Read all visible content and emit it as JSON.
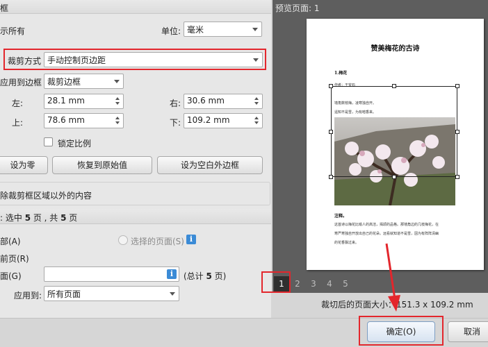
{
  "left": {
    "section1_title": "框",
    "show_all_label": "示所有",
    "unit_label": "单位:",
    "unit_value": "毫米",
    "crop_method_label": "裁剪方式",
    "crop_method_value": "手动控制页边距",
    "apply_border_label": "应用到边框",
    "apply_border_value": "裁剪边框",
    "left_label": "左:",
    "left_value": "28.1 mm",
    "right_label": "右:",
    "right_value": "30.6 mm",
    "top_label": "上:",
    "top_value": "78.6 mm",
    "bottom_label": "下:",
    "bottom_value": "109.2 mm",
    "lock_ratio_label": "锁定比例",
    "btn_set_zero": "设为零",
    "btn_restore": "恢复到原始值",
    "btn_set_blank": "设为空白外边框",
    "remove_outside_label": "除裁剪框区域以外的内容"
  },
  "pages": {
    "header_prefix": ": 选中 ",
    "header_selected": "5",
    "header_mid": " 页 , 共 ",
    "header_total": "5",
    "header_suffix": " 页",
    "all_label": "部(A)",
    "selected_pages_label": "选择的页面(S)",
    "current_label": "前页(R)",
    "pages_label": "面(G)",
    "pages_input_value": "",
    "total_prefix": "(总计 ",
    "total_value": "5",
    "total_suffix": " 页)",
    "apply_to_label": "应用到:",
    "apply_to_value": "所有页面"
  },
  "preview": {
    "title": "预览页面: 1",
    "doc": {
      "title": "赞美梅花的古诗",
      "heading": "1.梅花",
      "author": "作者：王安石",
      "line1": "墙角数枝梅，凌寒独自开。",
      "line2": "遥知不是雪，为有暗香来。",
      "note_heading": "注释。",
      "note1": "这首诗以梅花比喻人的高洁，揭颂的品格。那墙角边的几枝梅花，在",
      "note2": "寒严寒独自开放出自己的花朵。远看就知道不是雪，因为有阵阵清幽",
      "note3": "的花香飘过来。"
    },
    "page_numbers": [
      "1",
      "2",
      "3",
      "4",
      "5"
    ],
    "active_page": "1"
  },
  "cropped_size_label": "裁切后的页面大小：151.3 x 109.2 mm",
  "ok_button": "确定(O)",
  "cancel_button": "取消",
  "colors": {
    "highlight_red": "#e3262c",
    "info_blue": "#3b8bd6",
    "preview_bg": "#5e5e5e"
  }
}
